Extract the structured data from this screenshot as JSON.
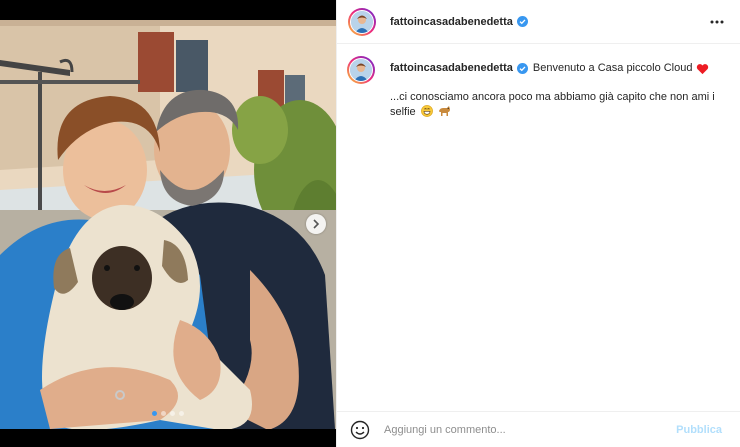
{
  "post": {
    "username": "fattoincasadabenedetta",
    "verified": true,
    "photo_alt": "",
    "carousel": {
      "total": 4,
      "active": 1
    }
  },
  "caption": {
    "username": "fattoincasadabenedetta",
    "message": "Benvenuto a Casa piccolo Cloud",
    "body": "...ci conosciamo ancora poco ma abbiamo già capito che non ami i selfie",
    "emojis": [
      "heart-icon",
      "grinning-face-icon",
      "dog-icon"
    ]
  },
  "comment": {
    "placeholder": "Aggiungi un commento...",
    "publish_label": "Pubblica"
  },
  "colors": {
    "verified": "#3897f0",
    "publish": "#b2dffc",
    "heart": "#ed1c24",
    "text": "#262626"
  }
}
